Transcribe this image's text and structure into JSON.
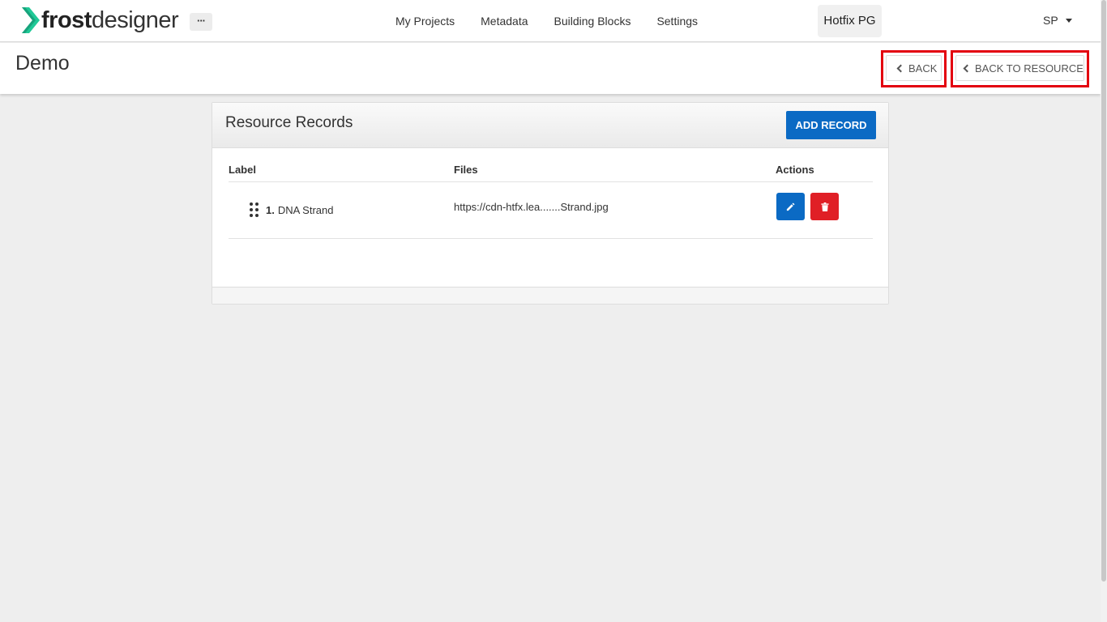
{
  "brand": {
    "bold": "frost",
    "light": "designer",
    "accent": "#20c997"
  },
  "header": {
    "more_label": "···",
    "nav": [
      "My Projects",
      "Metadata",
      "Building Blocks",
      "Settings"
    ],
    "project": "Hotfix PG",
    "user": "SP"
  },
  "page": {
    "title": "Demo",
    "back_label": "BACK",
    "back_to_resource_label": "BACK TO RESOURCE"
  },
  "records": {
    "title": "Resource Records",
    "add_label": "ADD RECORD",
    "columns": [
      "Label",
      "Files",
      "Actions"
    ],
    "rows": [
      {
        "number": "1.",
        "label": "DNA Strand",
        "file": "https://cdn-htfx.lea.......Strand.jpg"
      }
    ]
  },
  "colors": {
    "primary": "#0b6ac4",
    "danger": "#e01f26",
    "highlight": "#e3000f"
  }
}
